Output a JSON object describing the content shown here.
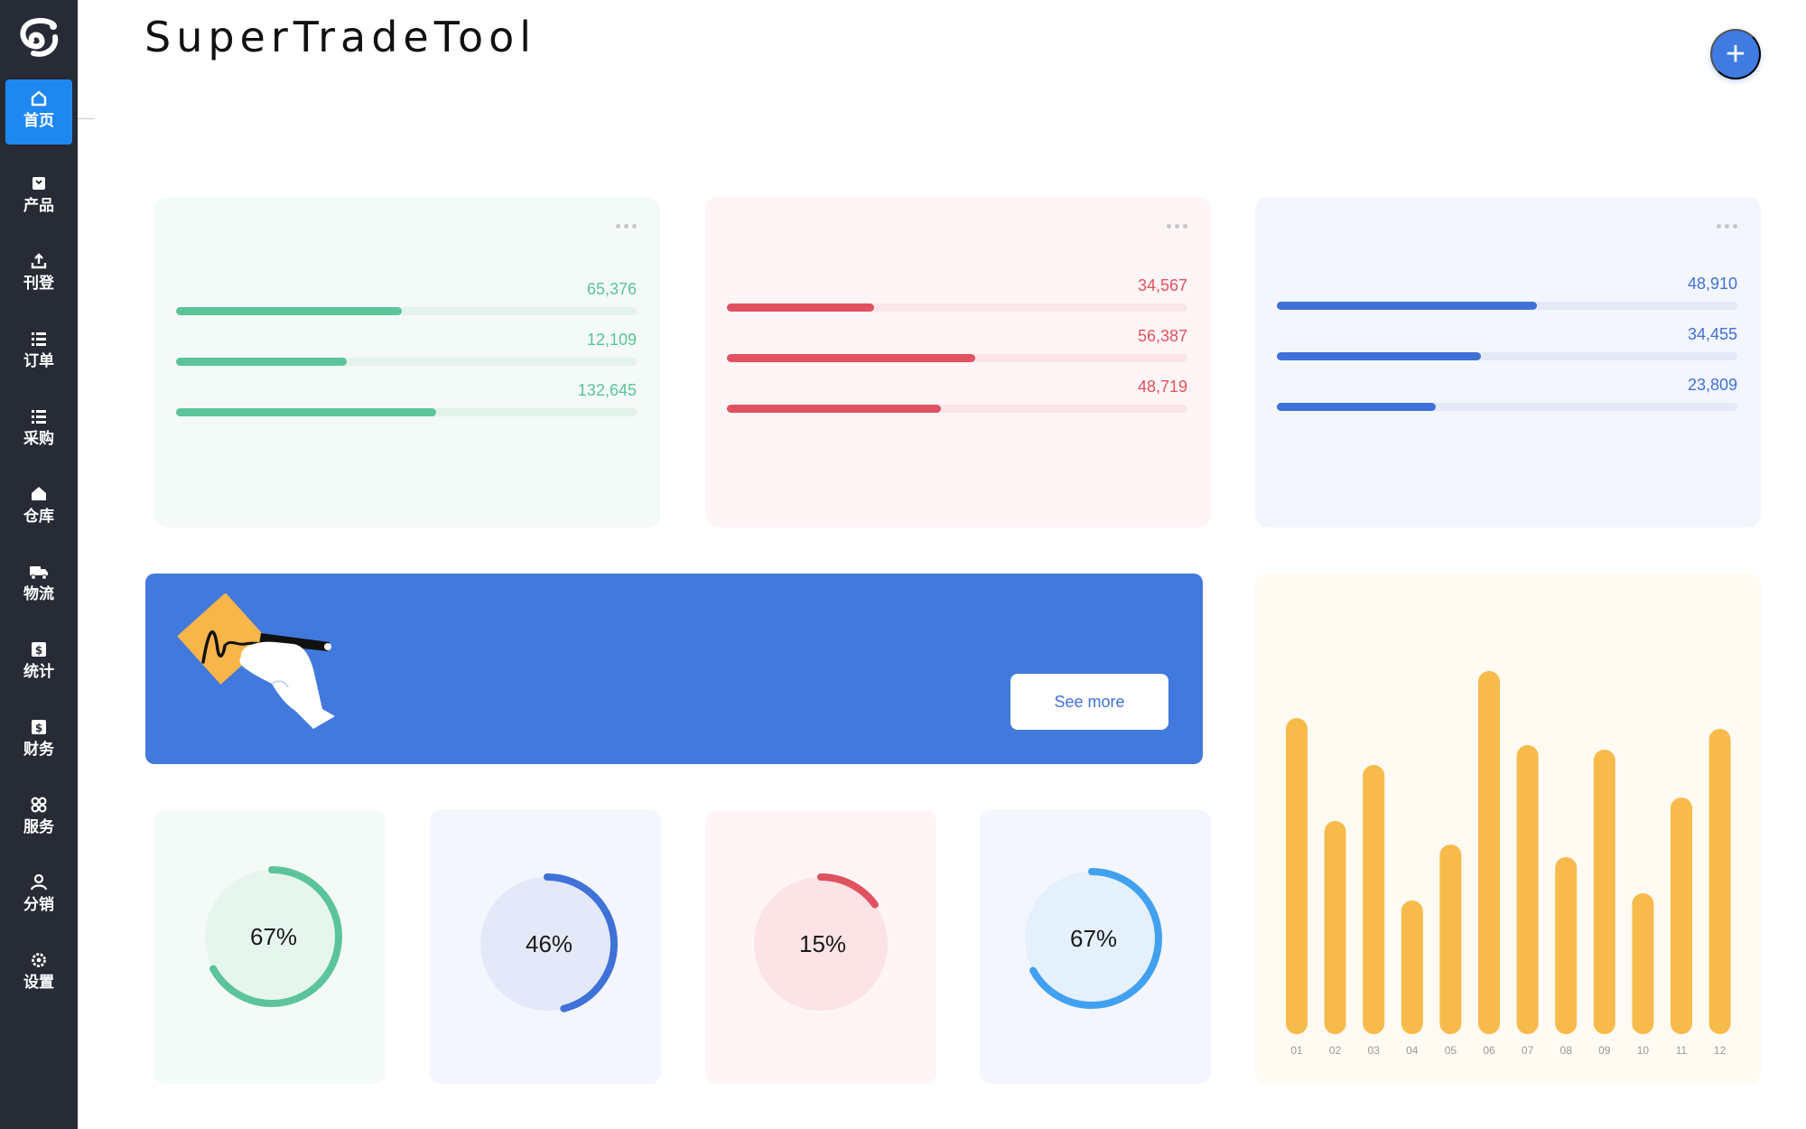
{
  "app": {
    "title": "SuperTradeTool",
    "add_button_label": "+"
  },
  "sidebar": {
    "logo_icon": "brand-logo-icon",
    "items": [
      {
        "label": "首页",
        "icon": "home-icon",
        "active": true
      },
      {
        "label": "产品",
        "icon": "product-icon",
        "active": false
      },
      {
        "label": "刊登",
        "icon": "upload-icon",
        "active": false
      },
      {
        "label": "订单",
        "icon": "list-icon",
        "active": false
      },
      {
        "label": "采购",
        "icon": "list-icon",
        "active": false
      },
      {
        "label": "仓库",
        "icon": "warehouse-icon",
        "active": false
      },
      {
        "label": "物流",
        "icon": "truck-icon",
        "active": false
      },
      {
        "label": "统计",
        "icon": "stats-icon",
        "active": false
      },
      {
        "label": "财务",
        "icon": "finance-icon",
        "active": false
      },
      {
        "label": "服务",
        "icon": "grid-icon",
        "active": false
      },
      {
        "label": "分销",
        "icon": "user-icon",
        "active": false
      },
      {
        "label": "设置",
        "icon": "settings-icon",
        "active": false
      }
    ]
  },
  "stat_cards": [
    {
      "theme": "green",
      "bg": "#f4faf7",
      "track": "#e3f3ec",
      "color": "#5cc49a",
      "rows": [
        {
          "value": "65,376",
          "fraction": 0.49
        },
        {
          "value": "12,109",
          "fraction": 0.37
        },
        {
          "value": "132,645",
          "fraction": 0.565
        }
      ]
    },
    {
      "theme": "red",
      "bg": "#fff5f6",
      "track": "#fbe5e8",
      "color": "#e0525f",
      "rows": [
        {
          "value": "34,567",
          "fraction": 0.32
        },
        {
          "value": "56,387",
          "fraction": 0.54
        },
        {
          "value": "48,719",
          "fraction": 0.465
        }
      ]
    },
    {
      "theme": "blue",
      "bg": "#f3f6fd",
      "track": "#e3e9f7",
      "color": "#3f71d8",
      "rows": [
        {
          "value": "48,910",
          "fraction": 0.565
        },
        {
          "value": "34,455",
          "fraction": 0.443
        },
        {
          "value": "23,809",
          "fraction": 0.345
        }
      ]
    }
  ],
  "banner": {
    "button_label": "See more",
    "art_icon": "signature-illustration-icon"
  },
  "donuts": [
    {
      "label": "67%",
      "percent": 67,
      "card_bg": "#f4faf7",
      "inner_bg": "#e6f5ee",
      "track": "#e6f5ee",
      "color": "#5cc49a",
      "start_deg": 0
    },
    {
      "label": "46%",
      "percent": 46,
      "card_bg": "#f3f6fd",
      "inner_bg": "#e3e9f9",
      "track": "#e3e9f9",
      "color": "#3f71d8",
      "start_deg": 0
    },
    {
      "label": "15%",
      "percent": 15,
      "card_bg": "#fff5f6",
      "inner_bg": "#fbe3e6",
      "track": "#fbe3e6",
      "color": "#e0525f",
      "start_deg": 0
    },
    {
      "label": "67%",
      "percent": 67,
      "card_bg": "#f3f6fd",
      "inner_bg": "#e4f0fc",
      "track": "#e4f0fc",
      "color": "#42a0f0",
      "start_deg": 0
    }
  ],
  "chart_data": {
    "type": "bar",
    "categories": [
      "01",
      "02",
      "03",
      "04",
      "05",
      "06",
      "07",
      "08",
      "09",
      "10",
      "11",
      "12"
    ],
    "values": [
      350,
      236,
      298,
      148,
      210,
      402,
      320,
      196,
      315,
      156,
      262,
      338
    ],
    "ylim": [
      0,
      420
    ],
    "color": "#f7bb4c",
    "title": "",
    "xlabel": "",
    "ylabel": ""
  }
}
